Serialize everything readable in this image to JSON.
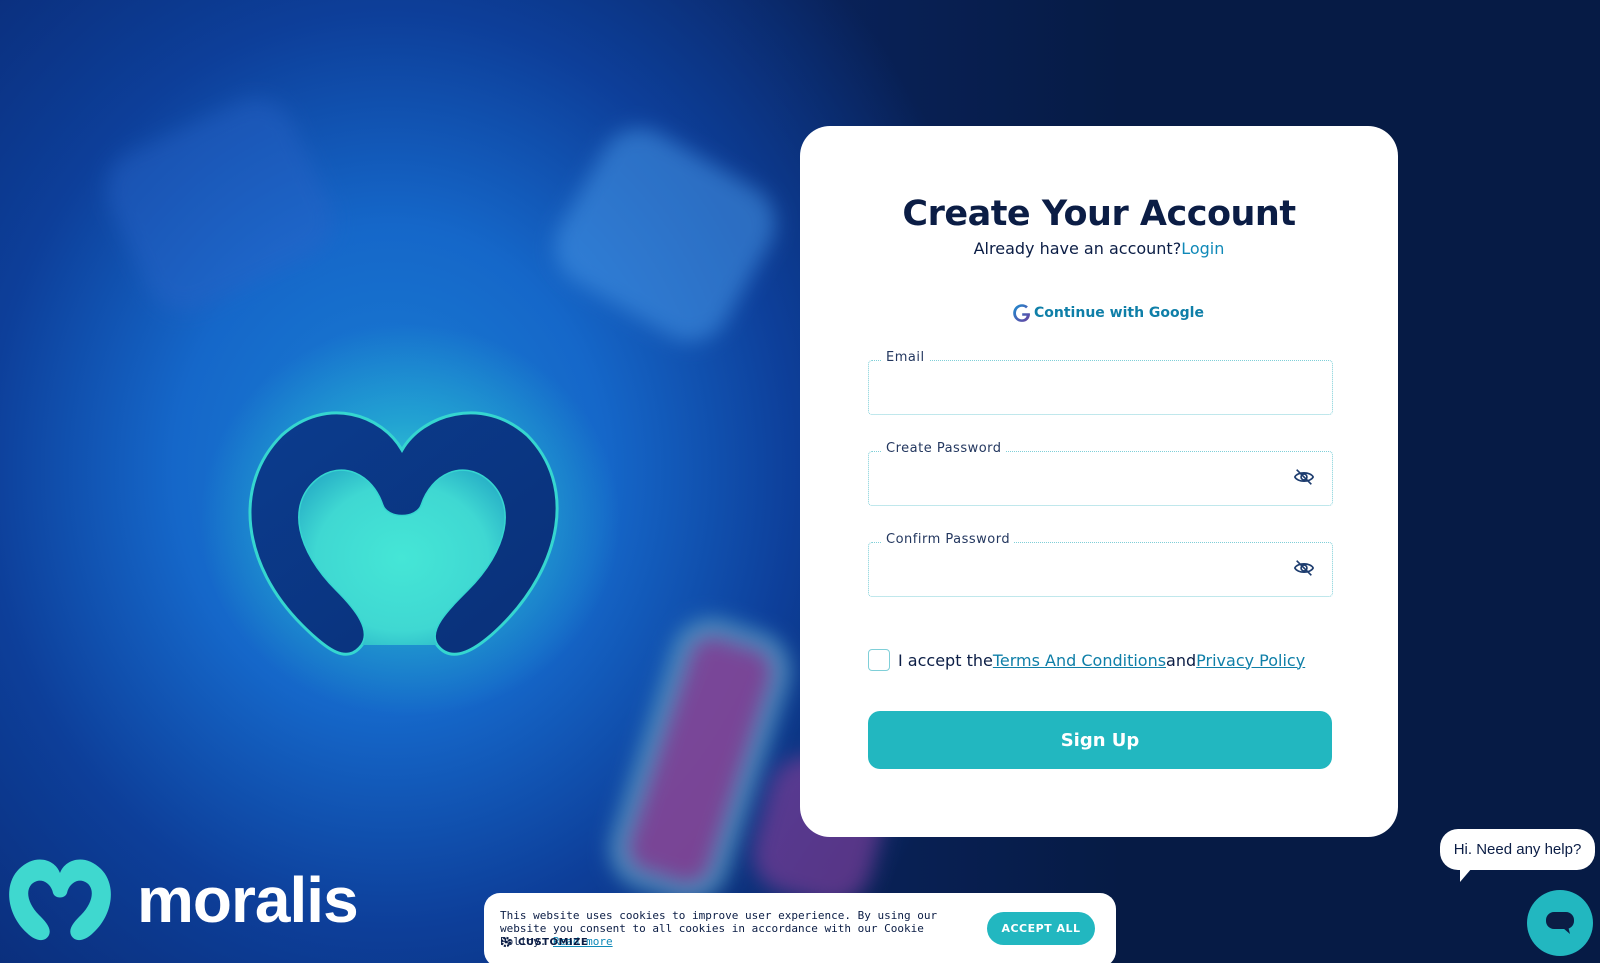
{
  "brand": {
    "name": "moralis",
    "colors": {
      "accent": "#22b7c0",
      "navy": "#0b1d45",
      "link": "#0f7fa8",
      "bg": "#061b45"
    }
  },
  "signup": {
    "title": "Create Your Account",
    "have_account": "Already have an account?",
    "login_link": "Login",
    "google_label": "Continue with Google",
    "email_label": "Email",
    "email_value": "",
    "password_label": "Create Password",
    "password_value": "",
    "confirm_label": "Confirm Password",
    "confirm_value": "",
    "terms_prefix": "I accept the",
    "terms_link": "Terms And Conditions",
    "terms_and": "and",
    "privacy_link": "Privacy Policy",
    "submit_label": "Sign Up"
  },
  "cookie": {
    "text": "This website uses cookies to improve user experience. By using our website you consent to all cookies in accordance with our Cookie Policy.",
    "read_more": "Read more",
    "customize": "CUSTOMIZE",
    "accept": "ACCEPT ALL"
  },
  "help": {
    "bubble": "Hi. Need any help?"
  },
  "icons": {
    "google": "google-icon",
    "eye_off": "eye-off-icon",
    "gear": "gear-icon",
    "chat": "chat-icon"
  }
}
